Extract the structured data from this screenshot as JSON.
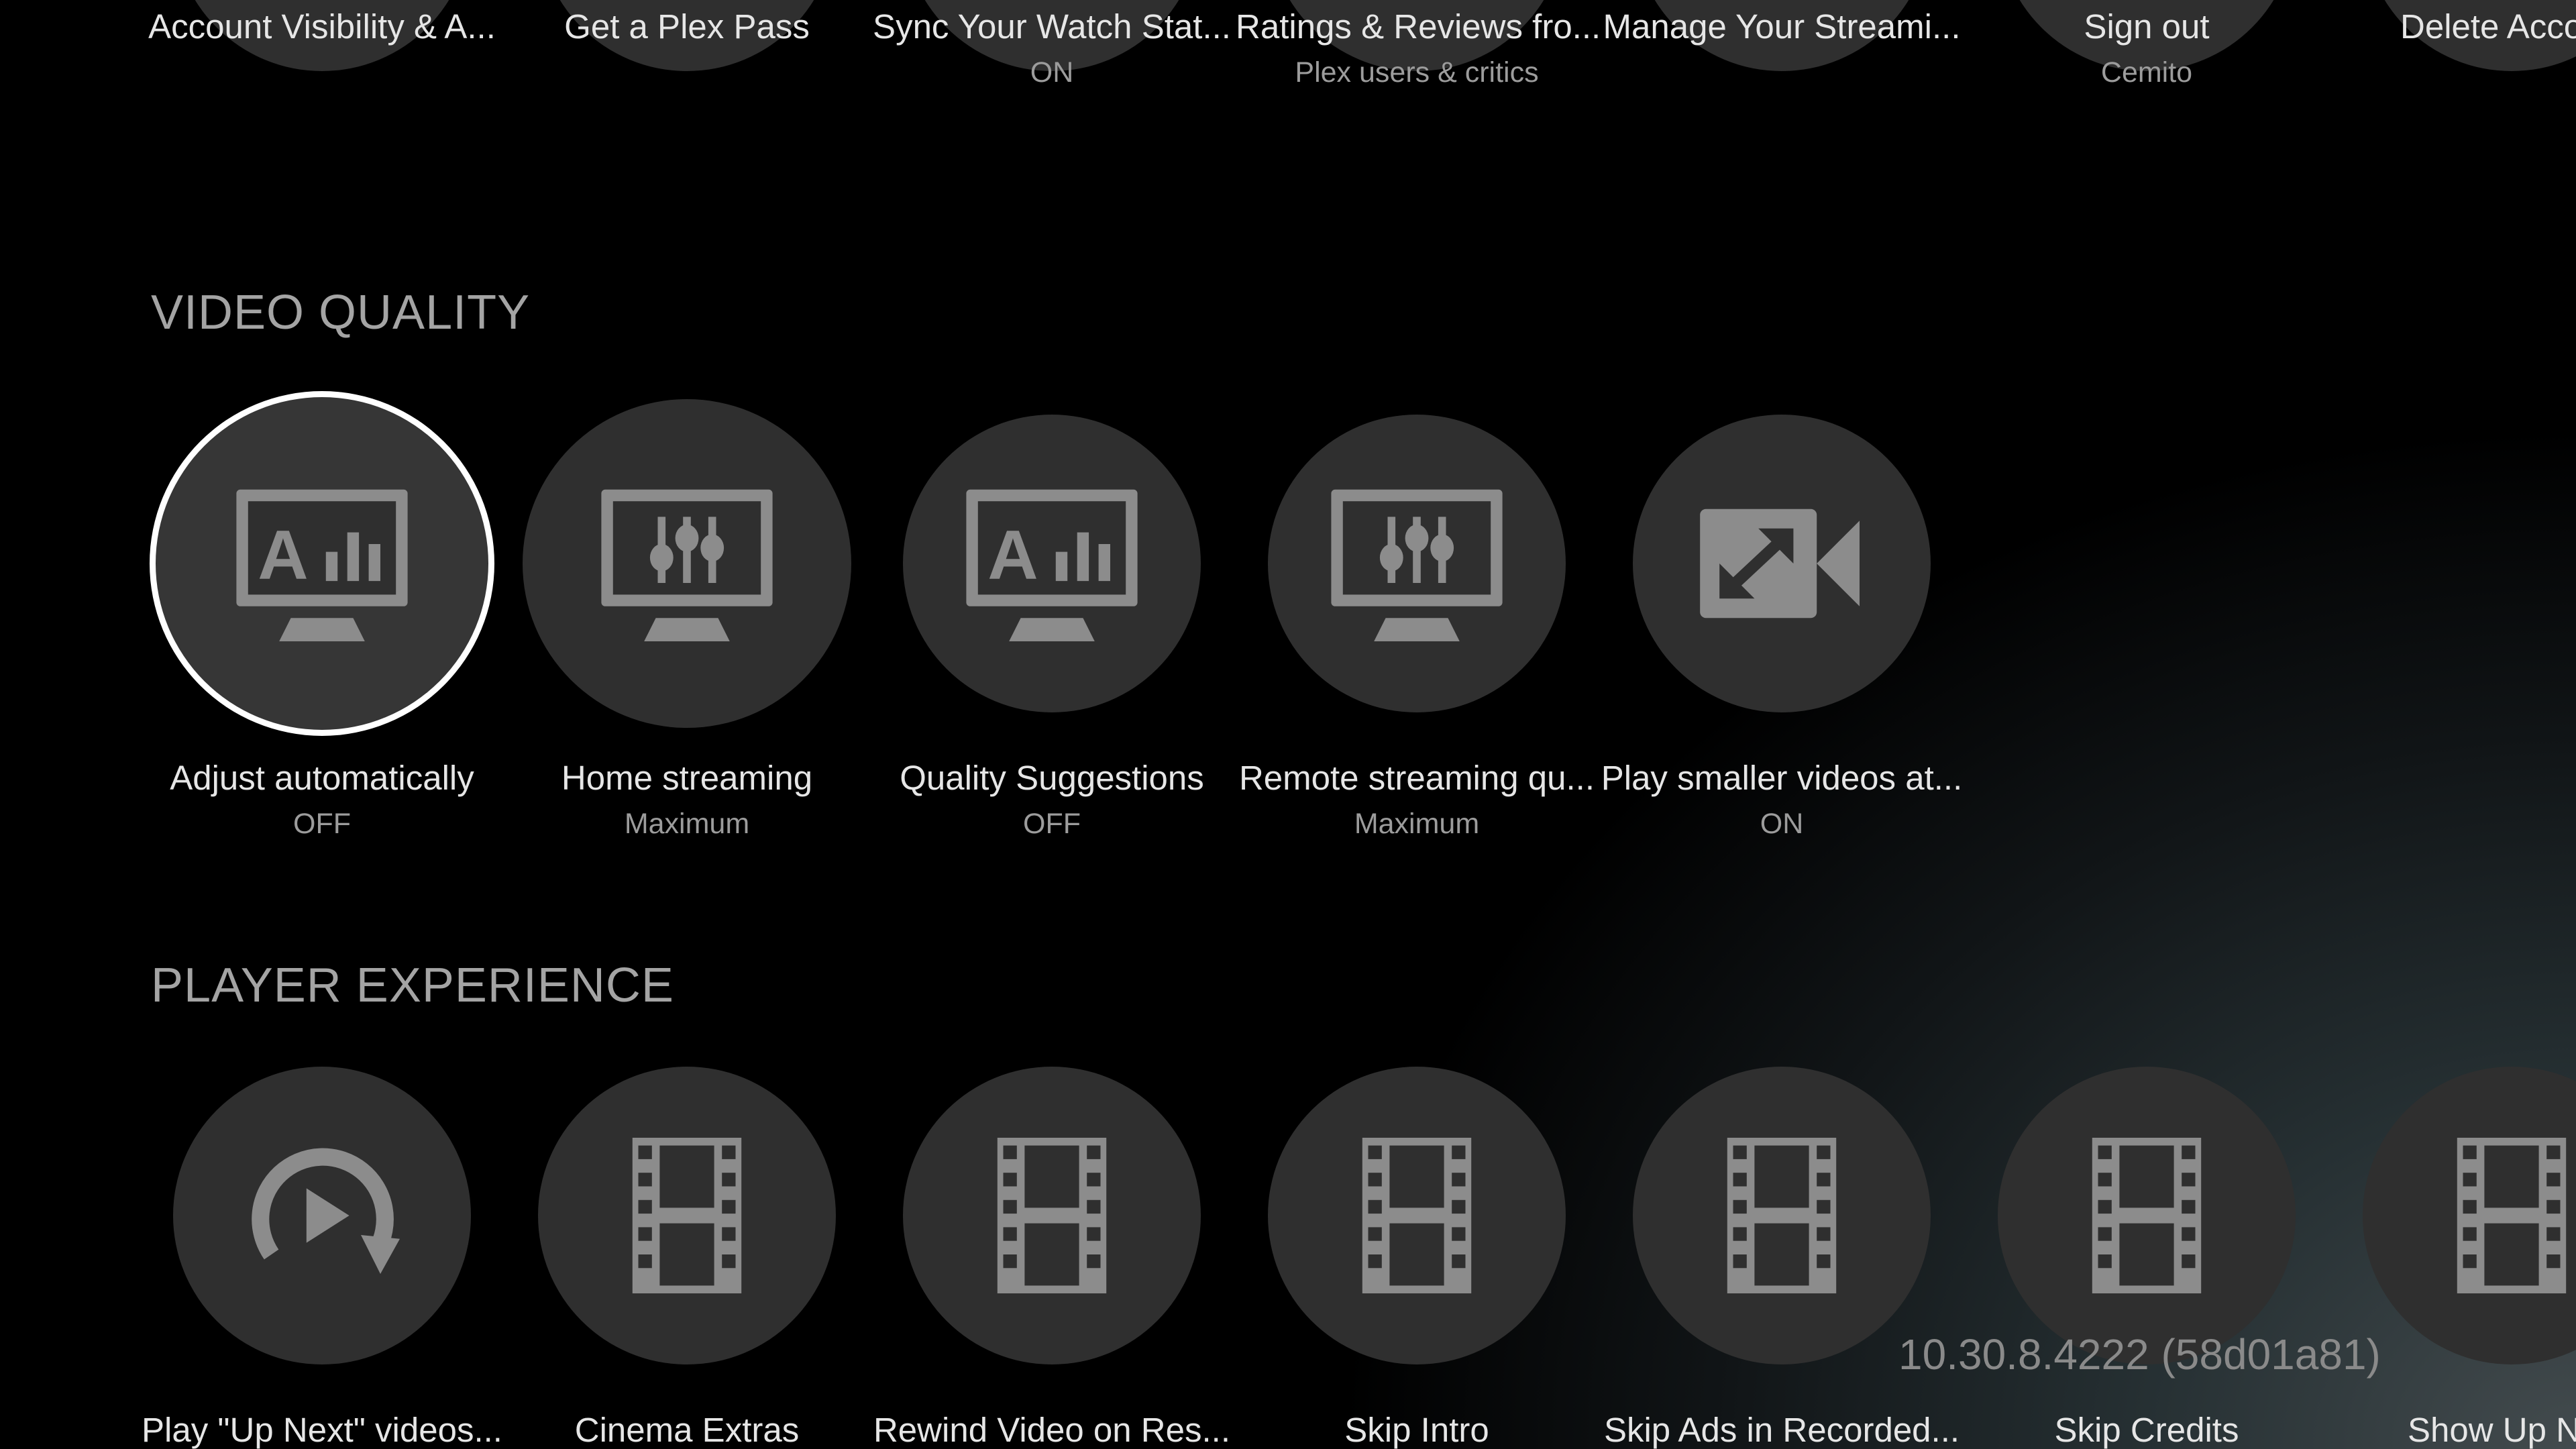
{
  "sections": {
    "account": {
      "items": [
        {
          "label": "Account Visibility & A...",
          "value": "",
          "icon": "account-icon"
        },
        {
          "label": "Get a Plex Pass",
          "value": "",
          "icon": "plex-pass-icon"
        },
        {
          "label": "Sync Your Watch Stat...",
          "value": "ON",
          "icon": "sync-icon"
        },
        {
          "label": "Ratings & Reviews fro...",
          "value": "Plex users & critics",
          "icon": "ratings-icon"
        },
        {
          "label": "Manage Your Streami...",
          "value": "",
          "icon": "streaming-services-icon"
        },
        {
          "label": "Sign out",
          "value": "Cemito",
          "icon": "sign-out-icon"
        },
        {
          "label": "Delete Acco",
          "value": "",
          "icon": "delete-account-icon"
        }
      ]
    },
    "video_quality": {
      "title": "VIDEO QUALITY",
      "items": [
        {
          "label": "Adjust automatically",
          "value": "OFF",
          "icon": "monitor-auto-quality-icon"
        },
        {
          "label": "Home streaming",
          "value": "Maximum",
          "icon": "monitor-sliders-icon"
        },
        {
          "label": "Quality Suggestions",
          "value": "OFF",
          "icon": "monitor-auto-quality-icon"
        },
        {
          "label": "Remote streaming qu...",
          "value": "Maximum",
          "icon": "monitor-sliders-icon"
        },
        {
          "label": "Play smaller videos at...",
          "value": "ON",
          "icon": "video-expand-icon"
        }
      ]
    },
    "player_experience": {
      "title": "PLAYER EXPERIENCE",
      "items": [
        {
          "label": "Play \"Up Next\" videos...",
          "icon": "replay-play-icon"
        },
        {
          "label": "Cinema Extras",
          "icon": "film-strip-icon"
        },
        {
          "label": "Rewind Video on Res...",
          "icon": "film-strip-icon"
        },
        {
          "label": "Skip Intro",
          "icon": "film-strip-icon"
        },
        {
          "label": "Skip Ads in Recorded...",
          "icon": "film-strip-icon"
        },
        {
          "label": "Skip Credits",
          "icon": "film-strip-icon"
        },
        {
          "label": "Show Up Ne",
          "icon": "film-strip-icon"
        }
      ]
    }
  },
  "version": "10.30.8.4222 (58d01a81)",
  "colors": {
    "circle": "#2f2f2f",
    "icon": "#8c8c8c",
    "focus_ring": "#ffffff",
    "section_title": "#a4a4a4"
  }
}
